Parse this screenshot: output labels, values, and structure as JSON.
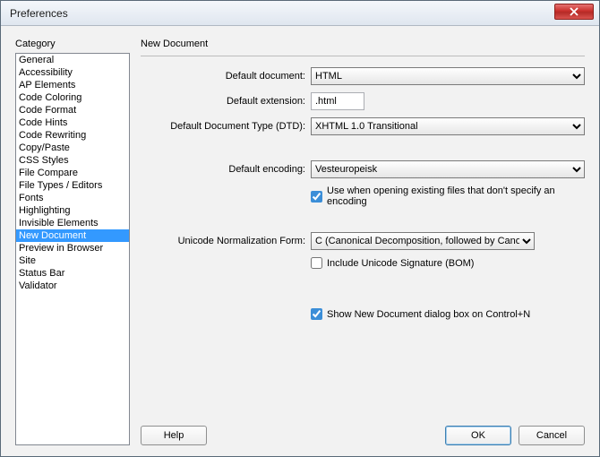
{
  "window": {
    "title": "Preferences"
  },
  "sidebar": {
    "label": "Category",
    "items": [
      "General",
      "Accessibility",
      "AP Elements",
      "Code Coloring",
      "Code Format",
      "Code Hints",
      "Code Rewriting",
      "Copy/Paste",
      "CSS Styles",
      "File Compare",
      "File Types / Editors",
      "Fonts",
      "Highlighting",
      "Invisible Elements",
      "New Document",
      "Preview in Browser",
      "Site",
      "Status Bar",
      "Validator"
    ],
    "selected_index": 14
  },
  "panel": {
    "heading": "New Document",
    "default_document_label": "Default document:",
    "default_document_value": "HTML",
    "default_extension_label": "Default extension:",
    "default_extension_value": ".html",
    "dtd_label": "Default Document Type (DTD):",
    "dtd_value": "XHTML 1.0 Transitional",
    "encoding_label": "Default encoding:",
    "encoding_value": "Vesteuropeisk",
    "use_when_opening_label": "Use when opening existing files that don't specify an encoding",
    "use_when_opening_checked": true,
    "unf_label": "Unicode Normalization Form:",
    "unf_value": "C (Canonical Decomposition, followed by Canonical Composition)",
    "bom_label": "Include Unicode Signature (BOM)",
    "bom_checked": false,
    "show_dialog_label": "Show New Document dialog box on Control+N",
    "show_dialog_checked": true
  },
  "buttons": {
    "help": "Help",
    "ok": "OK",
    "cancel": "Cancel"
  }
}
